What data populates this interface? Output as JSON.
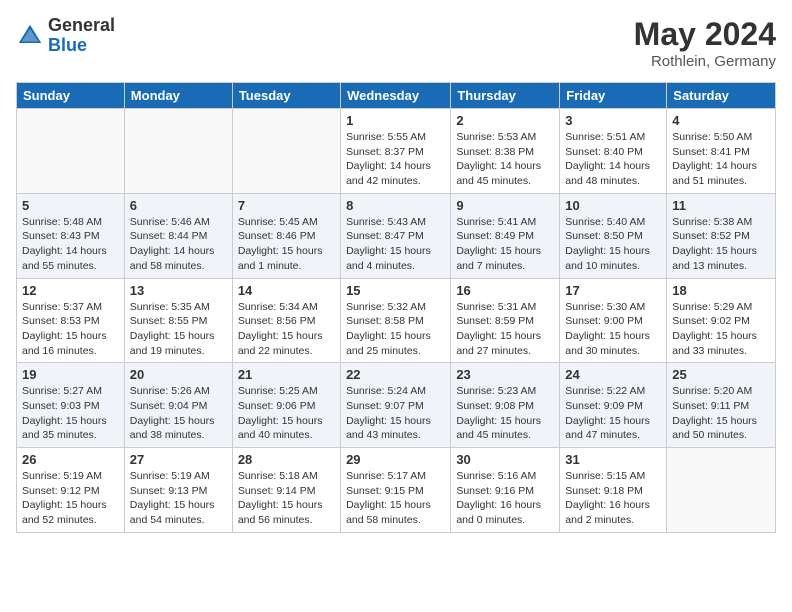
{
  "header": {
    "logo": {
      "general": "General",
      "blue": "Blue"
    },
    "title": "May 2024",
    "subtitle": "Rothlein, Germany"
  },
  "days_of_week": [
    "Sunday",
    "Monday",
    "Tuesday",
    "Wednesday",
    "Thursday",
    "Friday",
    "Saturday"
  ],
  "weeks": [
    [
      {
        "day": "",
        "info": ""
      },
      {
        "day": "",
        "info": ""
      },
      {
        "day": "",
        "info": ""
      },
      {
        "day": "1",
        "info": "Sunrise: 5:55 AM\nSunset: 8:37 PM\nDaylight: 14 hours\nand 42 minutes."
      },
      {
        "day": "2",
        "info": "Sunrise: 5:53 AM\nSunset: 8:38 PM\nDaylight: 14 hours\nand 45 minutes."
      },
      {
        "day": "3",
        "info": "Sunrise: 5:51 AM\nSunset: 8:40 PM\nDaylight: 14 hours\nand 48 minutes."
      },
      {
        "day": "4",
        "info": "Sunrise: 5:50 AM\nSunset: 8:41 PM\nDaylight: 14 hours\nand 51 minutes."
      }
    ],
    [
      {
        "day": "5",
        "info": "Sunrise: 5:48 AM\nSunset: 8:43 PM\nDaylight: 14 hours\nand 55 minutes."
      },
      {
        "day": "6",
        "info": "Sunrise: 5:46 AM\nSunset: 8:44 PM\nDaylight: 14 hours\nand 58 minutes."
      },
      {
        "day": "7",
        "info": "Sunrise: 5:45 AM\nSunset: 8:46 PM\nDaylight: 15 hours\nand 1 minute."
      },
      {
        "day": "8",
        "info": "Sunrise: 5:43 AM\nSunset: 8:47 PM\nDaylight: 15 hours\nand 4 minutes."
      },
      {
        "day": "9",
        "info": "Sunrise: 5:41 AM\nSunset: 8:49 PM\nDaylight: 15 hours\nand 7 minutes."
      },
      {
        "day": "10",
        "info": "Sunrise: 5:40 AM\nSunset: 8:50 PM\nDaylight: 15 hours\nand 10 minutes."
      },
      {
        "day": "11",
        "info": "Sunrise: 5:38 AM\nSunset: 8:52 PM\nDaylight: 15 hours\nand 13 minutes."
      }
    ],
    [
      {
        "day": "12",
        "info": "Sunrise: 5:37 AM\nSunset: 8:53 PM\nDaylight: 15 hours\nand 16 minutes."
      },
      {
        "day": "13",
        "info": "Sunrise: 5:35 AM\nSunset: 8:55 PM\nDaylight: 15 hours\nand 19 minutes."
      },
      {
        "day": "14",
        "info": "Sunrise: 5:34 AM\nSunset: 8:56 PM\nDaylight: 15 hours\nand 22 minutes."
      },
      {
        "day": "15",
        "info": "Sunrise: 5:32 AM\nSunset: 8:58 PM\nDaylight: 15 hours\nand 25 minutes."
      },
      {
        "day": "16",
        "info": "Sunrise: 5:31 AM\nSunset: 8:59 PM\nDaylight: 15 hours\nand 27 minutes."
      },
      {
        "day": "17",
        "info": "Sunrise: 5:30 AM\nSunset: 9:00 PM\nDaylight: 15 hours\nand 30 minutes."
      },
      {
        "day": "18",
        "info": "Sunrise: 5:29 AM\nSunset: 9:02 PM\nDaylight: 15 hours\nand 33 minutes."
      }
    ],
    [
      {
        "day": "19",
        "info": "Sunrise: 5:27 AM\nSunset: 9:03 PM\nDaylight: 15 hours\nand 35 minutes."
      },
      {
        "day": "20",
        "info": "Sunrise: 5:26 AM\nSunset: 9:04 PM\nDaylight: 15 hours\nand 38 minutes."
      },
      {
        "day": "21",
        "info": "Sunrise: 5:25 AM\nSunset: 9:06 PM\nDaylight: 15 hours\nand 40 minutes."
      },
      {
        "day": "22",
        "info": "Sunrise: 5:24 AM\nSunset: 9:07 PM\nDaylight: 15 hours\nand 43 minutes."
      },
      {
        "day": "23",
        "info": "Sunrise: 5:23 AM\nSunset: 9:08 PM\nDaylight: 15 hours\nand 45 minutes."
      },
      {
        "day": "24",
        "info": "Sunrise: 5:22 AM\nSunset: 9:09 PM\nDaylight: 15 hours\nand 47 minutes."
      },
      {
        "day": "25",
        "info": "Sunrise: 5:20 AM\nSunset: 9:11 PM\nDaylight: 15 hours\nand 50 minutes."
      }
    ],
    [
      {
        "day": "26",
        "info": "Sunrise: 5:19 AM\nSunset: 9:12 PM\nDaylight: 15 hours\nand 52 minutes."
      },
      {
        "day": "27",
        "info": "Sunrise: 5:19 AM\nSunset: 9:13 PM\nDaylight: 15 hours\nand 54 minutes."
      },
      {
        "day": "28",
        "info": "Sunrise: 5:18 AM\nSunset: 9:14 PM\nDaylight: 15 hours\nand 56 minutes."
      },
      {
        "day": "29",
        "info": "Sunrise: 5:17 AM\nSunset: 9:15 PM\nDaylight: 15 hours\nand 58 minutes."
      },
      {
        "day": "30",
        "info": "Sunrise: 5:16 AM\nSunset: 9:16 PM\nDaylight: 16 hours\nand 0 minutes."
      },
      {
        "day": "31",
        "info": "Sunrise: 5:15 AM\nSunset: 9:18 PM\nDaylight: 16 hours\nand 2 minutes."
      },
      {
        "day": "",
        "info": ""
      }
    ]
  ]
}
